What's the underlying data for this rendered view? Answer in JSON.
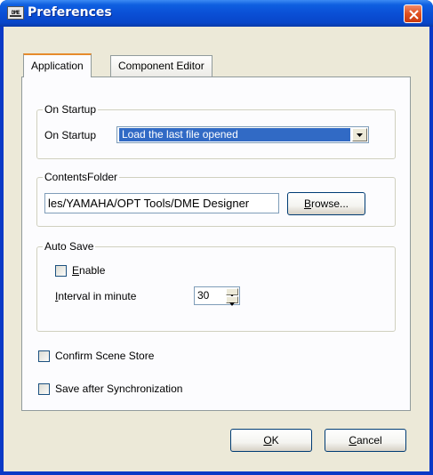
{
  "window": {
    "title": "Preferences",
    "icon_text": "DME"
  },
  "tabs": [
    {
      "label": "Application",
      "active": true
    },
    {
      "label": "Component Editor",
      "active": false
    }
  ],
  "on_startup": {
    "group_label": "On Startup",
    "field_label": "On Startup",
    "selected_value": "Load the last file opened"
  },
  "contents_folder": {
    "group_label": "ContentsFolder",
    "path_value": "les/YAMAHA/OPT Tools/DME Designer",
    "browse_label_mnemonic": "B",
    "browse_label_rest": "rowse..."
  },
  "auto_save": {
    "group_label": "Auto Save",
    "enable_mnemonic": "E",
    "enable_rest": "nable",
    "enable_checked": false,
    "interval_mnemonic": "I",
    "interval_rest": "nterval in minute",
    "interval_value": "30"
  },
  "options": {
    "confirm_scene_store": "Confirm Scene Store",
    "confirm_scene_store_checked": false,
    "save_after_sync": "Save after Synchronization",
    "save_after_sync_checked": false
  },
  "buttons": {
    "ok_mnemonic": "O",
    "ok_rest": "K",
    "cancel_mnemonic": "C",
    "cancel_rest": "ancel"
  },
  "colors": {
    "title_bar": "#0a4fd6",
    "selection": "#316ac5",
    "dialog_bg": "#ece9d8",
    "close_button": "#e0501f"
  },
  "icons": [
    "app-icon",
    "close-icon",
    "dropdown-arrow-icon",
    "spin-up-icon",
    "spin-down-icon"
  ]
}
